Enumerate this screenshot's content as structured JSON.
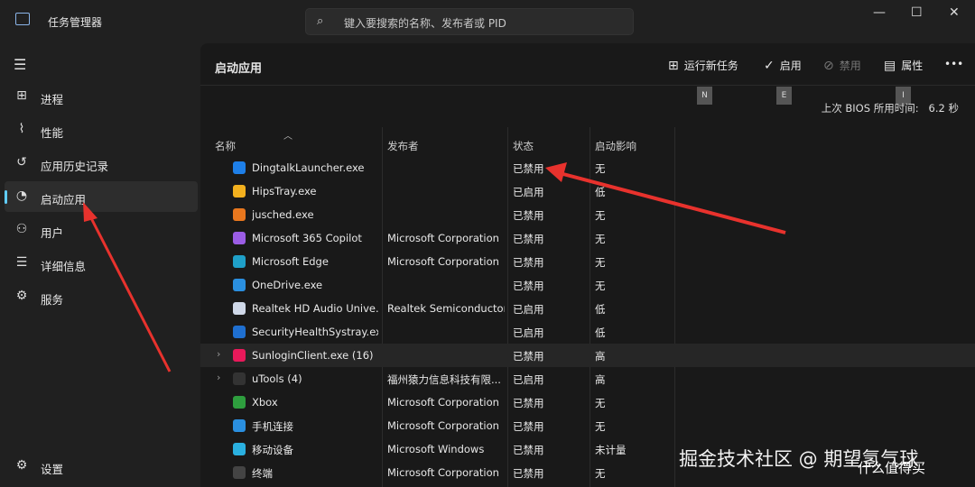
{
  "window": {
    "title": "任务管理器",
    "search_placeholder": "键入要搜索的名称、发布者或 PID"
  },
  "sidebar": {
    "items": [
      {
        "label": "进程",
        "icon": "processes-icon"
      },
      {
        "label": "性能",
        "icon": "performance-icon"
      },
      {
        "label": "应用历史记录",
        "icon": "history-icon"
      },
      {
        "label": "启动应用",
        "icon": "startup-icon",
        "active": true
      },
      {
        "label": "用户",
        "icon": "users-icon"
      },
      {
        "label": "详细信息",
        "icon": "details-icon"
      },
      {
        "label": "服务",
        "icon": "services-icon"
      }
    ],
    "settings": "设置"
  },
  "main": {
    "title": "启动应用",
    "toolbar": {
      "run_new_task": "运行新任务",
      "enable": "启用",
      "disable": "禁用",
      "properties": "属性",
      "more": "•••"
    },
    "key_chips": [
      "N",
      "E",
      "I"
    ],
    "bios_label": "上次 BIOS 所用时间:",
    "bios_value": "6.2 秒",
    "columns": [
      "名称",
      "发布者",
      "状态",
      "启动影响"
    ],
    "rows": [
      {
        "name": "DingtalkLauncher.exe",
        "publisher": "",
        "status": "已禁用",
        "impact": "无",
        "color": "#1e7fe8"
      },
      {
        "name": "HipsTray.exe",
        "publisher": "",
        "status": "已启用",
        "impact": "低",
        "color": "#f2b01e"
      },
      {
        "name": "jusched.exe",
        "publisher": "",
        "status": "已禁用",
        "impact": "无",
        "color": "#e8771e"
      },
      {
        "name": "Microsoft 365 Copilot",
        "publisher": "Microsoft Corporation",
        "status": "已禁用",
        "impact": "无",
        "color": "#9b5de5"
      },
      {
        "name": "Microsoft Edge",
        "publisher": "Microsoft Corporation",
        "status": "已禁用",
        "impact": "无",
        "color": "#1fa0c8"
      },
      {
        "name": "OneDrive.exe",
        "publisher": "",
        "status": "已禁用",
        "impact": "无",
        "color": "#2a8fe0"
      },
      {
        "name": "Realtek HD Audio Unive...",
        "publisher": "Realtek Semiconductor",
        "status": "已启用",
        "impact": "低",
        "color": "#cfd8e8"
      },
      {
        "name": "SecurityHealthSystray.exe",
        "publisher": "",
        "status": "已启用",
        "impact": "低",
        "color": "#1f6fd0"
      },
      {
        "name": "SunloginClient.exe (16)",
        "publisher": "",
        "status": "已禁用",
        "impact": "高",
        "color": "#e8195a",
        "expand": true,
        "highlight": true
      },
      {
        "name": "uTools (4)",
        "publisher": "福州猿力信息科技有限...",
        "status": "已启用",
        "impact": "高",
        "color": "#333",
        "expand": true
      },
      {
        "name": "Xbox",
        "publisher": "Microsoft Corporation",
        "status": "已禁用",
        "impact": "无",
        "color": "#2e9e3e"
      },
      {
        "name": "手机连接",
        "publisher": "Microsoft Corporation",
        "status": "已禁用",
        "impact": "无",
        "color": "#2a8fe0"
      },
      {
        "name": "移动设备",
        "publisher": "Microsoft Windows",
        "status": "已禁用",
        "impact": "未计量",
        "color": "#2ab0e0"
      },
      {
        "name": "终端",
        "publisher": "Microsoft Corporation",
        "status": "已禁用",
        "impact": "无",
        "color": "#444"
      }
    ]
  },
  "watermark": "掘金技术社区 @ 期望氢气球",
  "logo": "什么值得买",
  "colors": {
    "accent": "#60cdff",
    "arrow": "#e8322d"
  }
}
